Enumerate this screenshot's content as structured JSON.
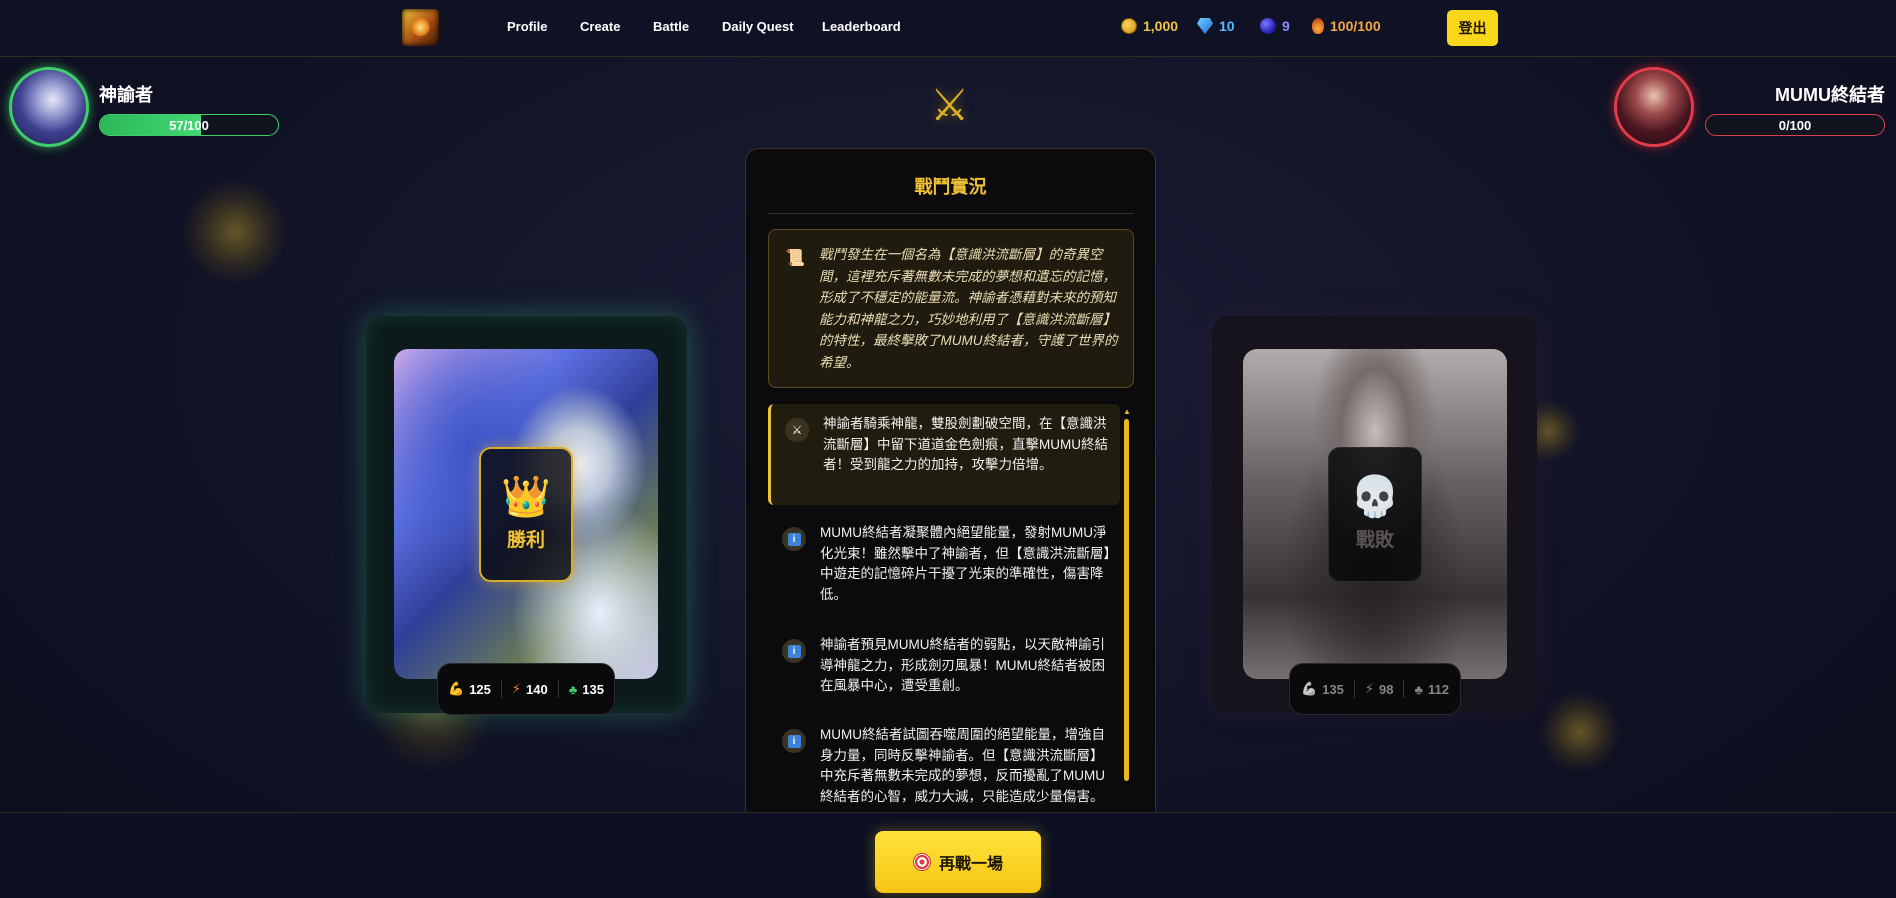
{
  "nav": {
    "links": [
      "Profile",
      "Create",
      "Battle",
      "Daily Quest",
      "Leaderboard"
    ],
    "resources": {
      "gold": "1,000",
      "gems": "10",
      "orbs": "9",
      "energy": "100/100"
    },
    "logout_label": "登出"
  },
  "player_left": {
    "name": "神諭者",
    "hp_text": "57/100",
    "hp_fraction": 0.57
  },
  "player_right": {
    "name": "MUMU終結者",
    "hp_text": "0/100",
    "hp_fraction": 0
  },
  "card_left": {
    "badge_label": "勝利",
    "stats": {
      "power": "125",
      "speed": "140",
      "luck": "135"
    }
  },
  "card_right": {
    "badge_label": "戰敗",
    "stats": {
      "power": "135",
      "speed": "98",
      "luck": "112"
    }
  },
  "battle_log": {
    "title": "戰鬥實況",
    "intro": "戰鬥發生在一個名為【意識洪流斷層】的奇異空間，這裡充斥著無數未完成的夢想和遺忘的記憶，形成了不穩定的能量流。神諭者憑藉對未來的預知能力和神龍之力，巧妙地利用了【意識洪流斷層】的特性，最終擊敗了MUMU終結者，守護了世界的希望。",
    "entries": [
      "神諭者騎乘神龍，雙股劍劃破空間，在【意識洪流斷層】中留下道道金色劍痕，直擊MUMU終結者！受到龍之力的加持，攻擊力倍增。",
      "MUMU終結者凝聚體內絕望能量，發射MUMU淨化光束！雖然擊中了神諭者，但【意識洪流斷層】中遊走的記憶碎片干擾了光束的準確性，傷害降低。",
      "神諭者預見MUMU終結者的弱點，以天敵神諭引導神龍之力，形成劍刃風暴！MUMU終結者被困在風暴中心，遭受重創。",
      "MUMU終結者試圖吞噬周圍的絕望能量，增強自身力量，同時反擊神諭者。但【意識洪流斷層】中充斥著無數未完成的夢想，反而擾亂了MUMU終結者的心智，威力大減，只能造成少量傷害。"
    ]
  },
  "play_again_label": "再戰一場",
  "icons": {
    "crossed_swords": "crossed-swords-icon",
    "crown": "crown-icon",
    "skull": "skull-icon"
  },
  "colors": {
    "accent": "#f0c035",
    "hp_left": "#3fcf6a",
    "hp_right": "#e03c4a"
  }
}
